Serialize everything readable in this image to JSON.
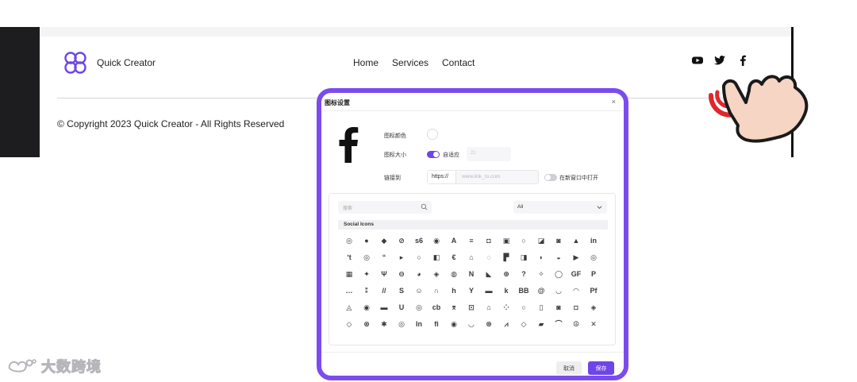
{
  "header": {
    "brand": "Quick Creator",
    "nav": [
      "Home",
      "Services",
      "Contact"
    ],
    "social_icons": [
      "youtube-icon",
      "twitter-icon",
      "facebook-icon"
    ]
  },
  "footer": {
    "copyright": "© Copyright 2023 Quick Creator - All Rights Reserved"
  },
  "watermark": {
    "text": "大数跨境"
  },
  "colors": {
    "accent": "#6d45e8",
    "modal_border": "#7a4cf0",
    "pointer": "#e0282c",
    "hand": "#f6d5c5",
    "sidebar": "#1d1d20"
  },
  "modal": {
    "title": "图标设置",
    "close": "×",
    "preview_icon": "facebook-f-icon",
    "color_label": "图标颜色",
    "size_label": "图标大小",
    "size_toggle_on": true,
    "size_auto_label": "自适应",
    "size_value": "21",
    "link_label": "链接到",
    "link_prefix": "https://",
    "link_placeholder": "www.link_to.com",
    "new_window_on": false,
    "new_window_label": "在新窗口中打开",
    "search_placeholder": "搜索",
    "filter_value": "All",
    "category": "Social Icons",
    "icons": [
      {
        "g": "◎",
        "n": "icon-0-0"
      },
      {
        "g": "●",
        "n": "icon-0-1"
      },
      {
        "g": "◆",
        "n": "icon-0-2"
      },
      {
        "g": "⊘",
        "n": "icon-0-3"
      },
      {
        "g": "s6",
        "n": "icon-0-4"
      },
      {
        "g": "◉",
        "n": "icon-0-5"
      },
      {
        "g": "A",
        "n": "icon-0-6"
      },
      {
        "g": "≡",
        "n": "icon-0-7"
      },
      {
        "g": "◘",
        "n": "icon-0-8"
      },
      {
        "g": "▣",
        "n": "icon-0-9"
      },
      {
        "g": "○",
        "n": "icon-0-10"
      },
      {
        "g": "◪",
        "n": "icon-0-11"
      },
      {
        "g": "◙",
        "n": "icon-0-12"
      },
      {
        "g": "▲",
        "n": "icon-0-13"
      },
      {
        "g": "in",
        "n": "icon-0-14"
      },
      {
        "g": "ʼt",
        "n": "icon-1-0"
      },
      {
        "g": "◎",
        "n": "icon-1-1"
      },
      {
        "g": "“",
        "n": "icon-1-2"
      },
      {
        "g": "▸",
        "n": "icon-1-3"
      },
      {
        "g": "○",
        "n": "icon-1-4"
      },
      {
        "g": "◧",
        "n": "icon-1-5"
      },
      {
        "g": "€",
        "n": "icon-1-6"
      },
      {
        "g": "⌂",
        "n": "icon-1-7"
      },
      {
        "g": "◌",
        "n": "icon-1-8"
      },
      {
        "g": "▛",
        "n": "icon-1-9"
      },
      {
        "g": "◨",
        "n": "icon-1-10"
      },
      {
        "g": "◗",
        "n": "icon-1-11"
      },
      {
        "g": "◒",
        "n": "icon-1-12"
      },
      {
        "g": "▶",
        "n": "icon-1-13"
      },
      {
        "g": "◎",
        "n": "icon-1-14"
      },
      {
        "g": "▦",
        "n": "icon-2-0"
      },
      {
        "g": "✦",
        "n": "icon-2-1"
      },
      {
        "g": "Ψ",
        "n": "icon-2-2"
      },
      {
        "g": "⊖",
        "n": "icon-2-3"
      },
      {
        "g": "◕",
        "n": "icon-2-4"
      },
      {
        "g": "◈",
        "n": "icon-2-5"
      },
      {
        "g": "◍",
        "n": "icon-2-6"
      },
      {
        "g": "N",
        "n": "icon-2-7"
      },
      {
        "g": "◣",
        "n": "icon-2-8"
      },
      {
        "g": "⊕",
        "n": "icon-2-9"
      },
      {
        "g": "?",
        "n": "icon-2-10"
      },
      {
        "g": "✧",
        "n": "icon-2-11"
      },
      {
        "g": "◯",
        "n": "icon-2-12"
      },
      {
        "g": "GF",
        "n": "icon-2-13"
      },
      {
        "g": "P",
        "n": "icon-2-14"
      },
      {
        "g": "…",
        "n": "icon-3-0"
      },
      {
        "g": "⁑",
        "n": "icon-3-1"
      },
      {
        "g": "//",
        "n": "icon-3-2"
      },
      {
        "g": "S",
        "n": "icon-3-3"
      },
      {
        "g": "☺",
        "n": "icon-3-4"
      },
      {
        "g": "∩",
        "n": "icon-3-5"
      },
      {
        "g": "h",
        "n": "icon-3-6"
      },
      {
        "g": "Y",
        "n": "icon-3-7"
      },
      {
        "g": "▬",
        "n": "icon-3-8"
      },
      {
        "g": "k",
        "n": "icon-3-9"
      },
      {
        "g": "BB",
        "n": "icon-3-10"
      },
      {
        "g": "@",
        "n": "icon-3-11"
      },
      {
        "g": "◡",
        "n": "icon-3-12"
      },
      {
        "g": "◠",
        "n": "icon-3-13"
      },
      {
        "g": "Pf",
        "n": "icon-3-14"
      },
      {
        "g": "◬",
        "n": "icon-4-0"
      },
      {
        "g": "◉",
        "n": "icon-4-1"
      },
      {
        "g": "▬",
        "n": "icon-4-2"
      },
      {
        "g": "U",
        "n": "icon-4-3"
      },
      {
        "g": "◎",
        "n": "icon-4-4"
      },
      {
        "g": "cb",
        "n": "icon-4-5"
      },
      {
        "g": "⌆",
        "n": "icon-4-6"
      },
      {
        "g": "⊡",
        "n": "icon-4-7"
      },
      {
        "g": "⌂",
        "n": "icon-4-8"
      },
      {
        "g": "⁘",
        "n": "icon-4-9"
      },
      {
        "g": "○",
        "n": "icon-4-10"
      },
      {
        "g": "▯",
        "n": "icon-4-11"
      },
      {
        "g": "◙",
        "n": "icon-4-12"
      },
      {
        "g": "◘",
        "n": "icon-4-13"
      },
      {
        "g": "◈",
        "n": "icon-4-14"
      },
      {
        "g": "◇",
        "n": "icon-5-0"
      },
      {
        "g": "⊗",
        "n": "icon-5-1"
      },
      {
        "g": "✱",
        "n": "icon-5-2"
      },
      {
        "g": "◎",
        "n": "icon-5-3"
      },
      {
        "g": "In",
        "n": "icon-5-4"
      },
      {
        "g": "fi",
        "n": "icon-5-5"
      },
      {
        "g": "◉",
        "n": "icon-5-6"
      },
      {
        "g": "◡",
        "n": "icon-5-7"
      },
      {
        "g": "⊛",
        "n": "icon-5-8"
      },
      {
        "g": "⩘",
        "n": "icon-5-9"
      },
      {
        "g": "◇",
        "n": "icon-5-10"
      },
      {
        "g": "▰",
        "n": "icon-5-11"
      },
      {
        "g": "⌒",
        "n": "icon-5-12"
      },
      {
        "g": "☮",
        "n": "icon-5-13"
      },
      {
        "g": "✕",
        "n": "icon-5-14"
      }
    ],
    "cancel_label": "取消",
    "save_label": "保存"
  }
}
